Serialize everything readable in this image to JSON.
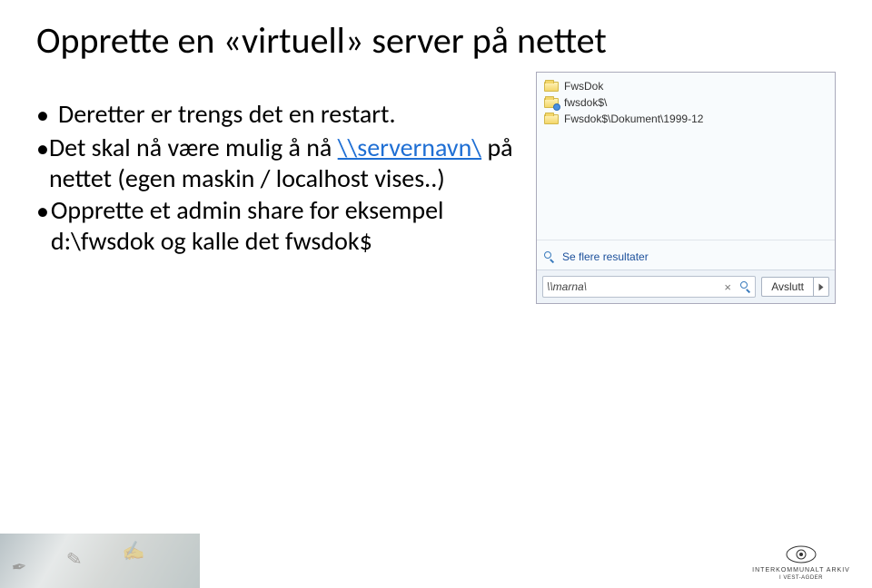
{
  "title": "Opprette en «virtuell» server på nettet",
  "bullets": [
    {
      "pre": "Deretter er trengs det en restart."
    },
    {
      "pre": "Det skal nå være mulig å nå ",
      "link": "\\\\servernavn\\",
      "post": " på nettet (egen maskin / localhost vises..)"
    },
    {
      "pre": "Opprette et admin share for eksempel d:\\fwsdok og kalle det fwsdok$"
    }
  ],
  "search": {
    "results": [
      {
        "label": "FwsDok"
      },
      {
        "label": "fwsdok$\\"
      },
      {
        "label": "Fwsdok$\\Dokument\\1999-12"
      }
    ],
    "more_label": "Se flere resultater",
    "query": "\\\\marna\\",
    "clear_glyph": "×",
    "shutdown_label": "Avslutt"
  },
  "logo": {
    "line1": "INTERKOMMUNALT ARKIV",
    "line2": "I VEST-AGDER"
  }
}
